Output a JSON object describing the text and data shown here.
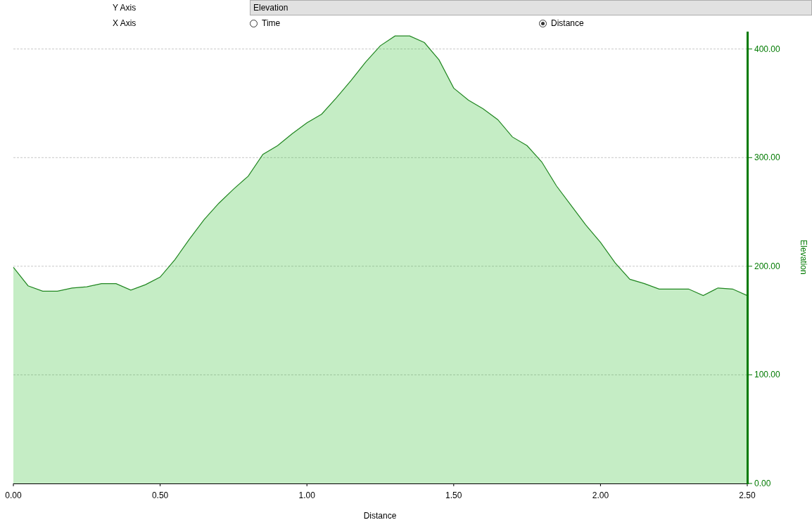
{
  "y_axis": {
    "label": "Y Axis",
    "value": "Elevation"
  },
  "x_axis": {
    "label": "X Axis",
    "options": [
      {
        "label": "Time",
        "selected": false
      },
      {
        "label": "Distance",
        "selected": true
      }
    ]
  },
  "chart": {
    "chart_data": {
      "type": "area",
      "xlabel": "Distance",
      "ylabel": "Elevation",
      "x": [
        0,
        0.05,
        0.1,
        0.15,
        0.2,
        0.25,
        0.3,
        0.35,
        0.4,
        0.45,
        0.5,
        0.55,
        0.6,
        0.65,
        0.7,
        0.75,
        0.8,
        0.85,
        0.9,
        0.95,
        1,
        1.05,
        1.1,
        1.15,
        1.2,
        1.25,
        1.3,
        1.35,
        1.4,
        1.45,
        1.5,
        1.55,
        1.6,
        1.65,
        1.7,
        1.75,
        1.8,
        1.85,
        1.9,
        1.95,
        2,
        2.05,
        2.1,
        2.15,
        2.2,
        2.25,
        2.3,
        2.35,
        2.4,
        2.45,
        2.5
      ],
      "grid": true,
      "series": [
        {
          "color": "#2ebf2e",
          "values": [
            199,
            182,
            177,
            177,
            180,
            181,
            184,
            184,
            178,
            183,
            190,
            206,
            225,
            243,
            258,
            271,
            283,
            303,
            311,
            322,
            332,
            340,
            355,
            371,
            388,
            403,
            412,
            412,
            406,
            390,
            364,
            353,
            345,
            335,
            319,
            311,
            296,
            274,
            256,
            238,
            222,
            203,
            188,
            184,
            179,
            179,
            179,
            173,
            180,
            179,
            173
          ]
        }
      ],
      "xlim": [
        0,
        2.5
      ],
      "ylim": [
        0,
        416
      ],
      "xticks": [
        {
          "value": 0,
          "label": "0.00"
        },
        {
          "value": 0.5,
          "label": "0.50"
        },
        {
          "value": 1,
          "label": "1.00"
        },
        {
          "value": 1.5,
          "label": "1.50"
        },
        {
          "value": 2,
          "label": "2.00"
        },
        {
          "value": 2.5,
          "label": "2.50"
        }
      ],
      "yticks": [
        {
          "value": 0,
          "label": "0.00"
        },
        {
          "value": 100,
          "label": "100.00"
        },
        {
          "value": 200,
          "label": "200.00"
        },
        {
          "value": 300,
          "label": "300.00"
        },
        {
          "value": 400,
          "label": "400.00"
        }
      ]
    }
  }
}
